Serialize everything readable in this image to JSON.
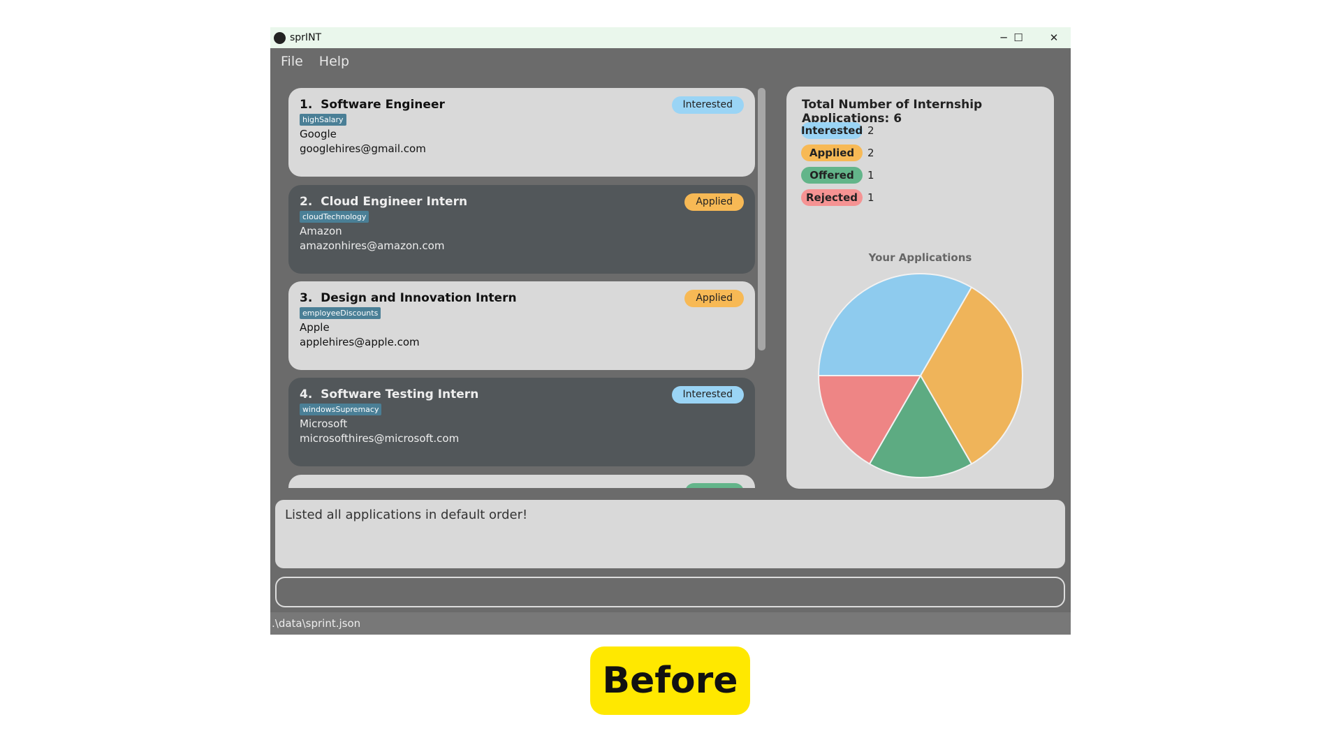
{
  "window": {
    "title": "sprINT",
    "minimize": "─",
    "maximize": "☐",
    "close": "✕"
  },
  "menu": {
    "file": "File",
    "help": "Help"
  },
  "applications": [
    {
      "index": "1.",
      "role": "Software Engineer",
      "tag": "highSalary",
      "company": "Google",
      "email": "googlehires@gmail.com",
      "status": "Interested",
      "theme": "light"
    },
    {
      "index": "2.",
      "role": "Cloud Engineer Intern",
      "tag": "cloudTechnology",
      "company": "Amazon",
      "email": "amazonhires@amazon.com",
      "status": "Applied",
      "theme": "dark"
    },
    {
      "index": "3.",
      "role": "Design and Innovation Intern",
      "tag": "employeeDiscounts",
      "company": "Apple",
      "email": "applehires@apple.com",
      "status": "Applied",
      "theme": "light"
    },
    {
      "index": "4.",
      "role": "Software Testing Intern",
      "tag": "windowsSupremacy",
      "company": "Microsoft",
      "email": "microsofthires@microsoft.com",
      "status": "Interested",
      "theme": "dark"
    }
  ],
  "status_colors": {
    "Interested": "#9ad4f5",
    "Applied": "#f7b955",
    "Offered": "#63b58a",
    "Rejected": "#f59393"
  },
  "stats": {
    "title": "Total Number of Internship Applications: 6",
    "rows": [
      {
        "label": "Interested",
        "count": "2"
      },
      {
        "label": "Applied",
        "count": "2"
      },
      {
        "label": "Offered",
        "count": "1"
      },
      {
        "label": "Rejected",
        "count": "1"
      }
    ]
  },
  "chart_data": {
    "type": "pie",
    "title": "Your Applications",
    "categories": [
      "Interested",
      "Applied",
      "Offered",
      "Rejected"
    ],
    "values": [
      2,
      2,
      1,
      1
    ],
    "colors": [
      "#8ecbee",
      "#efb45a",
      "#5dab82",
      "#ee8585"
    ]
  },
  "result": {
    "message": "Listed all applications in default order!"
  },
  "command": {
    "value": ""
  },
  "statusbar": {
    "path": ".\\data\\sprint.json"
  },
  "caption": "Before"
}
